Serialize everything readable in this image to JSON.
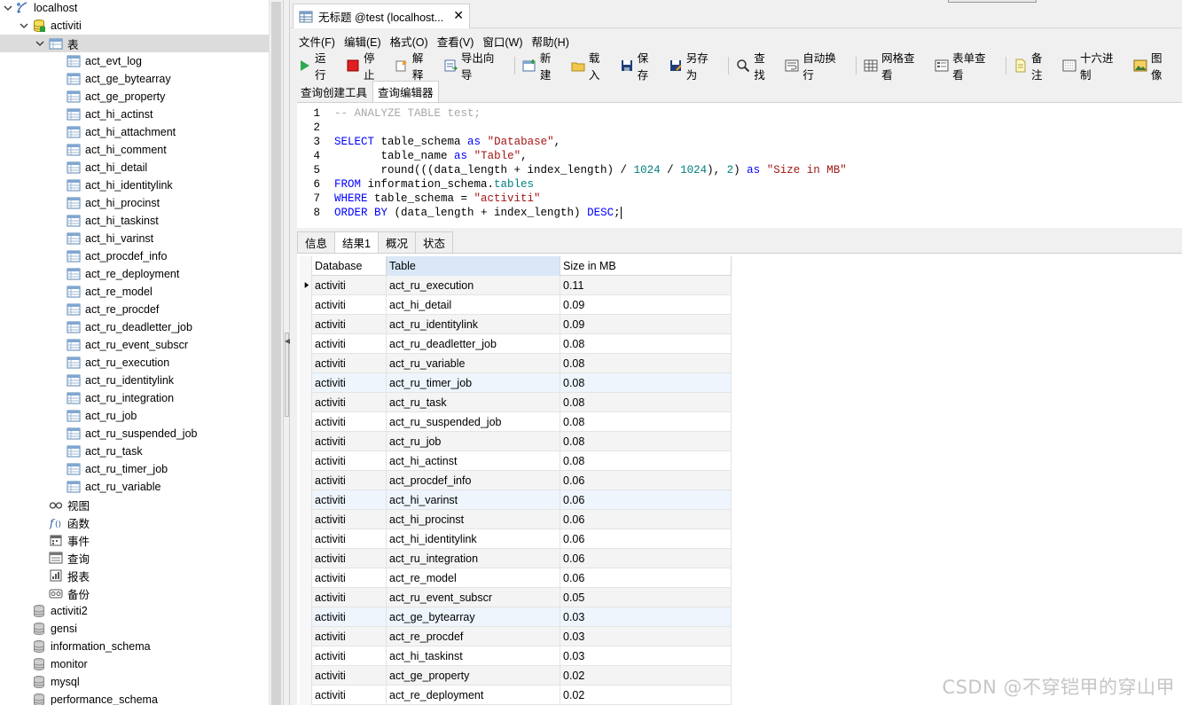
{
  "tree": {
    "connection": "localhost",
    "database": "activiti",
    "tables_folder": "表",
    "tables": [
      "act_evt_log",
      "act_ge_bytearray",
      "act_ge_property",
      "act_hi_actinst",
      "act_hi_attachment",
      "act_hi_comment",
      "act_hi_detail",
      "act_hi_identitylink",
      "act_hi_procinst",
      "act_hi_taskinst",
      "act_hi_varinst",
      "act_procdef_info",
      "act_re_deployment",
      "act_re_model",
      "act_re_procdef",
      "act_ru_deadletter_job",
      "act_ru_event_subscr",
      "act_ru_execution",
      "act_ru_identitylink",
      "act_ru_integration",
      "act_ru_job",
      "act_ru_suspended_job",
      "act_ru_task",
      "act_ru_timer_job",
      "act_ru_variable"
    ],
    "folders": [
      {
        "label": "视图",
        "icon": "view-icon"
      },
      {
        "label": "函数",
        "icon": "function-icon"
      },
      {
        "label": "事件",
        "icon": "event-icon"
      },
      {
        "label": "查询",
        "icon": "query-icon"
      },
      {
        "label": "报表",
        "icon": "report-icon"
      },
      {
        "label": "备份",
        "icon": "backup-icon"
      }
    ],
    "other_databases": [
      "activiti2",
      "gensi",
      "information_schema",
      "monitor",
      "mysql",
      "performance_schema"
    ]
  },
  "doc_tab": {
    "title": "无标题 @test (localhost...",
    "close": "✕"
  },
  "menu": [
    "文件(F)",
    "编辑(E)",
    "格式(O)",
    "查看(V)",
    "窗口(W)",
    "帮助(H)"
  ],
  "toolbar": [
    {
      "label": "运行",
      "icon": "run-icon"
    },
    {
      "label": "停止",
      "icon": "stop-icon"
    },
    {
      "label": "解释",
      "icon": "explain-icon"
    },
    {
      "label": "导出向导",
      "icon": "export-icon"
    },
    {
      "sep": true
    },
    {
      "label": "新建",
      "icon": "new-icon"
    },
    {
      "label": "载入",
      "icon": "load-icon"
    },
    {
      "label": "保存",
      "icon": "save-icon"
    },
    {
      "label": "另存为",
      "icon": "save-as-icon"
    },
    {
      "sep": true
    },
    {
      "label": "查找",
      "icon": "find-icon"
    },
    {
      "label": "自动换行",
      "icon": "wrap-icon"
    },
    {
      "sep": true
    },
    {
      "label": "网格查看",
      "icon": "grid-view-icon"
    },
    {
      "label": "表单查看",
      "icon": "form-view-icon"
    },
    {
      "sep": true
    },
    {
      "label": "备注",
      "icon": "memo-icon"
    },
    {
      "label": "十六进制",
      "icon": "hex-icon"
    },
    {
      "label": "图像",
      "icon": "image-icon"
    }
  ],
  "sub_tabs": [
    "查询创建工具",
    "查询编辑器"
  ],
  "sql_lines": [
    [
      {
        "t": "-- ANALYZE TABLE test;",
        "c": "c-comment"
      }
    ],
    [],
    [
      {
        "t": "SELECT",
        "c": "c-kw"
      },
      {
        "t": " table_schema "
      },
      {
        "t": "as",
        "c": "c-kw"
      },
      {
        "t": " "
      },
      {
        "t": "\"Database\"",
        "c": "c-str"
      },
      {
        "t": ","
      }
    ],
    [
      {
        "t": "       table_name "
      },
      {
        "t": "as",
        "c": "c-kw"
      },
      {
        "t": " "
      },
      {
        "t": "\"Table\"",
        "c": "c-str"
      },
      {
        "t": ","
      }
    ],
    [
      {
        "t": "       round(((data_length + index_length) / "
      },
      {
        "t": "1024",
        "c": "c-num"
      },
      {
        "t": " / "
      },
      {
        "t": "1024",
        "c": "c-num"
      },
      {
        "t": "), "
      },
      {
        "t": "2",
        "c": "c-num"
      },
      {
        "t": ") "
      },
      {
        "t": "as",
        "c": "c-kw"
      },
      {
        "t": " "
      },
      {
        "t": "\"Size in MB\"",
        "c": "c-str"
      }
    ],
    [
      {
        "t": "FROM",
        "c": "c-kw"
      },
      {
        "t": " information_schema."
      },
      {
        "t": "tables",
        "c": "c-fld"
      }
    ],
    [
      {
        "t": "WHERE",
        "c": "c-kw"
      },
      {
        "t": " table_schema = "
      },
      {
        "t": "\"activiti\"",
        "c": "c-str"
      }
    ],
    [
      {
        "t": "ORDER BY",
        "c": "c-kw"
      },
      {
        "t": " (data_length + index_length) "
      },
      {
        "t": "DESC",
        "c": "c-kw"
      },
      {
        "t": ";"
      }
    ]
  ],
  "result_tabs": [
    "信息",
    "结果1",
    "概况",
    "状态"
  ],
  "grid": {
    "columns": [
      "Database",
      "Table",
      "Size in MB"
    ],
    "rows": [
      [
        "activiti",
        "act_ru_execution",
        "0.11"
      ],
      [
        "activiti",
        "act_hi_detail",
        "0.09"
      ],
      [
        "activiti",
        "act_ru_identitylink",
        "0.09"
      ],
      [
        "activiti",
        "act_ru_deadletter_job",
        "0.08"
      ],
      [
        "activiti",
        "act_ru_variable",
        "0.08"
      ],
      [
        "activiti",
        "act_ru_timer_job",
        "0.08"
      ],
      [
        "activiti",
        "act_ru_task",
        "0.08"
      ],
      [
        "activiti",
        "act_ru_suspended_job",
        "0.08"
      ],
      [
        "activiti",
        "act_ru_job",
        "0.08"
      ],
      [
        "activiti",
        "act_hi_actinst",
        "0.08"
      ],
      [
        "activiti",
        "act_procdef_info",
        "0.06"
      ],
      [
        "activiti",
        "act_hi_varinst",
        "0.06"
      ],
      [
        "activiti",
        "act_hi_procinst",
        "0.06"
      ],
      [
        "activiti",
        "act_hi_identitylink",
        "0.06"
      ],
      [
        "activiti",
        "act_ru_integration",
        "0.06"
      ],
      [
        "activiti",
        "act_re_model",
        "0.06"
      ],
      [
        "activiti",
        "act_ru_event_subscr",
        "0.05"
      ],
      [
        "activiti",
        "act_ge_bytearray",
        "0.03"
      ],
      [
        "activiti",
        "act_re_procdef",
        "0.03"
      ],
      [
        "activiti",
        "act_hi_taskinst",
        "0.03"
      ],
      [
        "activiti",
        "act_ge_property",
        "0.02"
      ],
      [
        "activiti",
        "act_re_deployment",
        "0.02"
      ]
    ]
  },
  "watermark": "CSDN @不穿铠甲的穿山甲"
}
